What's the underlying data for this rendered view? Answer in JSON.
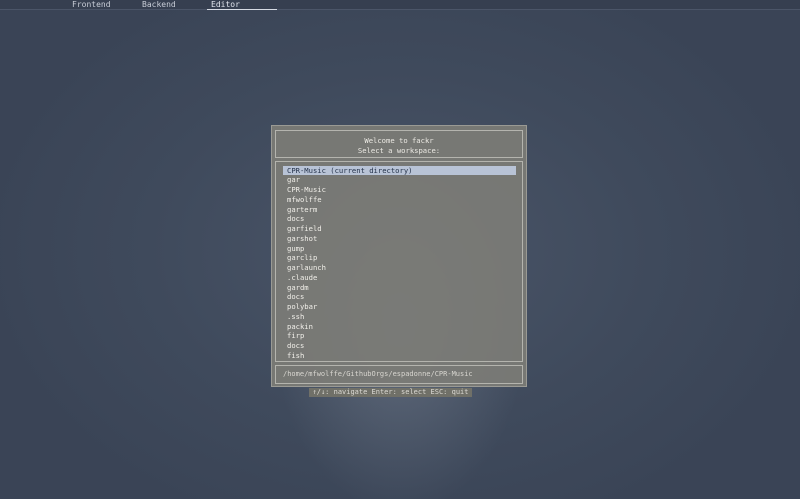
{
  "tabs": [
    {
      "label": "Frontend"
    },
    {
      "label": "Backend"
    },
    {
      "label": "Editor",
      "active": true
    }
  ],
  "dialog": {
    "title": "Welcome to fackr",
    "subtitle": "Select a workspace:",
    "items": [
      "CPR-Music (current directory)",
      "gar",
      "CPR-Music",
      "mfwolffe",
      "garterm",
      "docs",
      "garfield",
      "garshot",
      "gump",
      "garclip",
      "garlaunch",
      ".claude",
      "gardm",
      "docs",
      "polybar",
      ".ssh",
      "packin",
      "firp",
      "docs",
      "fish"
    ],
    "selected_index": 0,
    "path": "/home/mfwolffe/GithubOrgs/espadonne/CPR-Music"
  },
  "hint": "↑/↓: navigate  Enter: select  ESC: quit",
  "colors": {
    "background": "#3f4a5c",
    "dialog": "#7c7c76",
    "selection": "#b8c3d6"
  }
}
